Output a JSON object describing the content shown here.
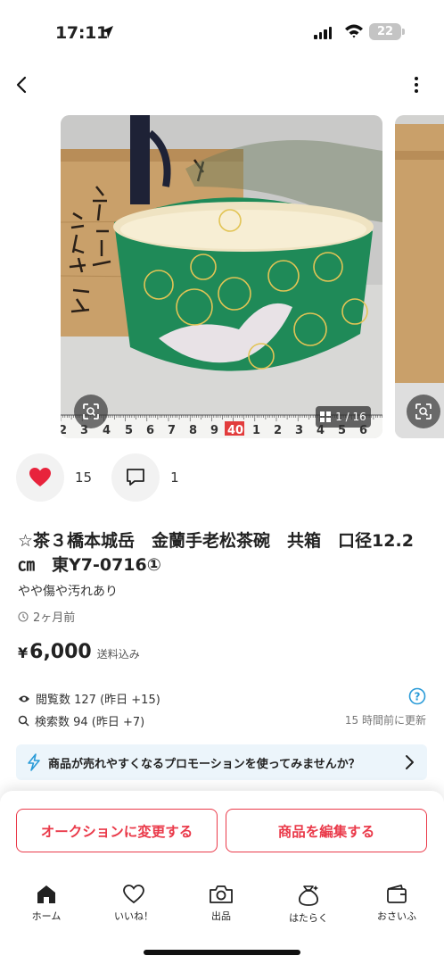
{
  "status_bar": {
    "time": "17:11",
    "battery": "22"
  },
  "gallery": {
    "counter": "1 / 16"
  },
  "ruler": {
    "digits": [
      "2",
      "3",
      "4",
      "5",
      "6",
      "7",
      "8",
      "9",
      "40",
      "1",
      "2",
      "3",
      "4",
      "5",
      "6"
    ]
  },
  "actions": {
    "like_count": "15",
    "comment_count": "1"
  },
  "item": {
    "title": "☆茶３橋本城岳　金蘭手老松茶碗　共箱　口径12.2㎝　東Y7-0716①",
    "condition": "やや傷や汚れあり",
    "posted": "2ヶ月前",
    "price_currency": "¥",
    "price": "6,000",
    "shipping": "送料込み"
  },
  "stats": {
    "views": "閲覧数  127 (昨日 +15)",
    "searches": "検索数  94 (昨日 +7)",
    "updated": "15 時間前に更新"
  },
  "promo": {
    "text": "商品が売れやすくなるプロモーションを使ってみませんか？"
  },
  "buttons": {
    "auction": "オークションに変更する",
    "edit": "商品を編集する"
  },
  "tabs": [
    {
      "label": "ホーム",
      "icon": "home-icon"
    },
    {
      "label": "いいね！",
      "icon": "heart-icon"
    },
    {
      "label": "出品",
      "icon": "camera-icon"
    },
    {
      "label": "はたらく",
      "icon": "money-bag-icon"
    },
    {
      "label": "おさいふ",
      "icon": "wallet-icon"
    }
  ],
  "colors": {
    "accent": "#ea3a4a",
    "like": "#e8233c",
    "promo_bg": "#ecf5fb",
    "promo_icon": "#2a9bd8",
    "help": "#2a9bd8"
  }
}
